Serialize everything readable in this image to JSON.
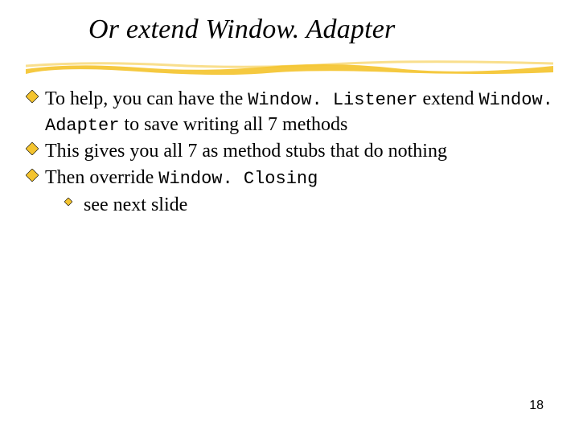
{
  "title": "Or extend Window. Adapter",
  "bullets": [
    {
      "segments": [
        {
          "text": "To help, you can have the ",
          "code": false
        },
        {
          "text": "Window. Listener",
          "code": true
        },
        {
          "text": " extend ",
          "code": false
        },
        {
          "text": "Window. Adapter",
          "code": true
        },
        {
          "text": " to save writing all 7 methods",
          "code": false
        }
      ]
    },
    {
      "segments": [
        {
          "text": "This gives you all 7 as method stubs that do nothing",
          "code": false
        }
      ]
    },
    {
      "segments": [
        {
          "text": "Then override ",
          "code": false
        },
        {
          "text": "Window. Closing",
          "code": true
        }
      ],
      "sub": [
        {
          "text": "see next slide"
        }
      ]
    }
  ],
  "page_number": "18",
  "colors": {
    "bullet_fill": "#f4c430",
    "bullet_stroke": "#000000",
    "underline": "#f4c430"
  }
}
